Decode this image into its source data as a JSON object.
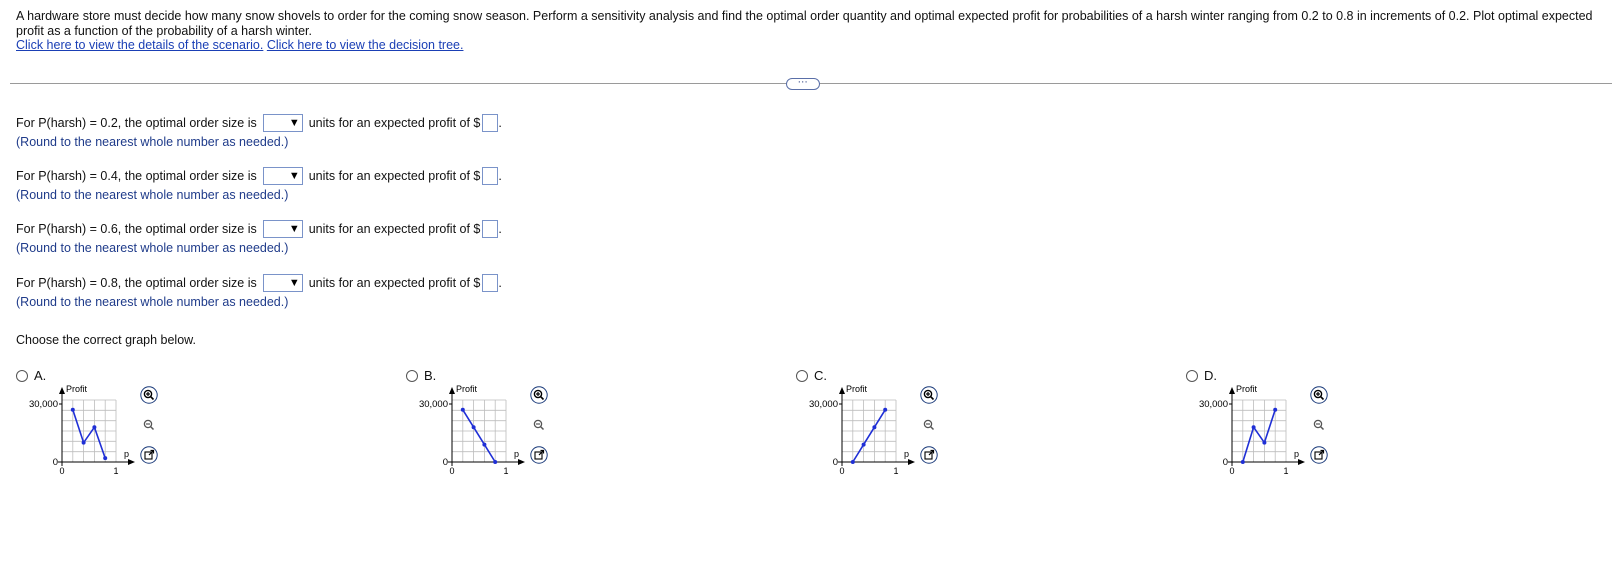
{
  "problem": {
    "text": "A hardware store must decide how many snow shovels to order for the coming snow season. Perform a sensitivity analysis and find the optimal order quantity and optimal expected profit for probabilities of a harsh winter ranging from 0.2 to 0.8 in increments of 0.2. Plot optimal expected profit as a function of the probability of a harsh winter.",
    "link_scenario": "Click here to view the details of the scenario.",
    "link_tree": "Click here to view the decision tree."
  },
  "more_button": "⋯",
  "questions": [
    {
      "prefix": "For P(harsh) = 0.2, the optimal order size is",
      "middle": "units for an expected profit of $",
      "hint": "(Round to the nearest whole number as needed.)"
    },
    {
      "prefix": "For P(harsh) = 0.4, the optimal order size is",
      "middle": "units for an expected profit of $",
      "hint": "(Round to the nearest whole number as needed.)"
    },
    {
      "prefix": "For P(harsh) = 0.6, the optimal order size is",
      "middle": "units for an expected profit of $",
      "hint": "(Round to the nearest whole number as needed.)"
    },
    {
      "prefix": "For P(harsh) = 0.8, the optimal order size is",
      "middle": "units for an expected profit of $",
      "hint": "(Round to the nearest whole number as needed.)"
    }
  ],
  "choose_text": "Choose the correct graph below.",
  "options": [
    {
      "label": "A."
    },
    {
      "label": "B."
    },
    {
      "label": "C."
    },
    {
      "label": "D."
    }
  ],
  "icons": {
    "zoom_in": "zoom-in-icon",
    "zoom_out": "zoom-out-icon",
    "popout": "popout-icon",
    "dropdown": "dropdown-arrow-icon"
  },
  "colors": {
    "series": "#1f2fd6",
    "link": "#1a3fb5",
    "hint": "#1f3b8a"
  },
  "chart_data": [
    {
      "type": "line",
      "option": "A",
      "ylabel": "Profit",
      "xlabel": "p",
      "x_ticks": [
        "0",
        "1"
      ],
      "y_ticks": [
        "0",
        "30,000"
      ],
      "xlim": [
        0,
        1
      ],
      "ylim": [
        0,
        30000
      ],
      "grid": true,
      "x": [
        0.2,
        0.4,
        0.6,
        0.8
      ],
      "y": [
        27000,
        10000,
        18000,
        2000
      ]
    },
    {
      "type": "line",
      "option": "B",
      "ylabel": "Profit",
      "xlabel": "p",
      "x_ticks": [
        "0",
        "1"
      ],
      "y_ticks": [
        "0",
        "30,000"
      ],
      "xlim": [
        0,
        1
      ],
      "ylim": [
        0,
        30000
      ],
      "grid": true,
      "x": [
        0.2,
        0.4,
        0.6,
        0.8
      ],
      "y": [
        27000,
        18000,
        9000,
        0
      ]
    },
    {
      "type": "line",
      "option": "C",
      "ylabel": "Profit",
      "xlabel": "p",
      "x_ticks": [
        "0",
        "1"
      ],
      "y_ticks": [
        "0",
        "30,000"
      ],
      "xlim": [
        0,
        1
      ],
      "ylim": [
        0,
        30000
      ],
      "grid": true,
      "x": [
        0.2,
        0.4,
        0.6,
        0.8
      ],
      "y": [
        0,
        9000,
        18000,
        27000
      ]
    },
    {
      "type": "line",
      "option": "D",
      "ylabel": "Profit",
      "xlabel": "p",
      "x_ticks": [
        "0",
        "1"
      ],
      "y_ticks": [
        "0",
        "30,000"
      ],
      "xlim": [
        0,
        1
      ],
      "ylim": [
        0,
        30000
      ],
      "grid": true,
      "x": [
        0.2,
        0.4,
        0.6,
        0.8
      ],
      "y": [
        0,
        18000,
        10000,
        27000
      ]
    }
  ]
}
